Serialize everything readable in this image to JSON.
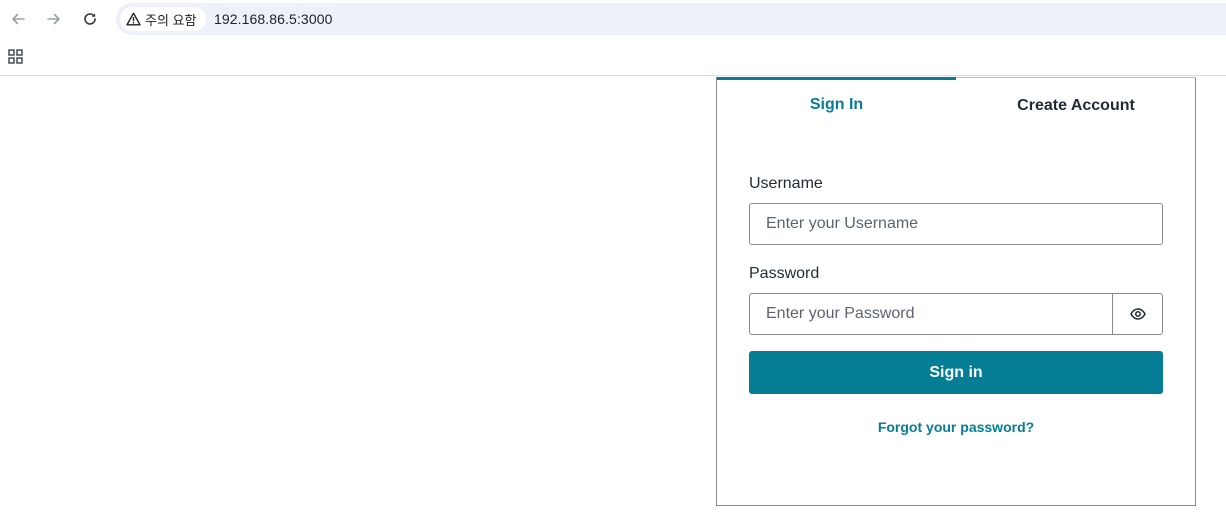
{
  "browser": {
    "security_label": "주의 요함",
    "url": "192.168.86.5:3000"
  },
  "tabs": {
    "signin_label": "Sign In",
    "create_label": "Create Account"
  },
  "form": {
    "username_label": "Username",
    "username_placeholder": "Enter your Username",
    "password_label": "Password",
    "password_placeholder": "Enter your Password",
    "signin_button": "Sign in",
    "forgot_link": "Forgot your password?"
  },
  "colors": {
    "accent": "#047d95",
    "text": "#1f2937",
    "border": "#8a8a8a",
    "address_bar_bg": "#edf2fa"
  },
  "icons": {
    "back": "back-arrow-icon",
    "forward": "forward-arrow-icon",
    "reload": "reload-icon",
    "warning": "warning-icon",
    "apps": "apps-grid-icon",
    "show_password": "eye-icon"
  }
}
